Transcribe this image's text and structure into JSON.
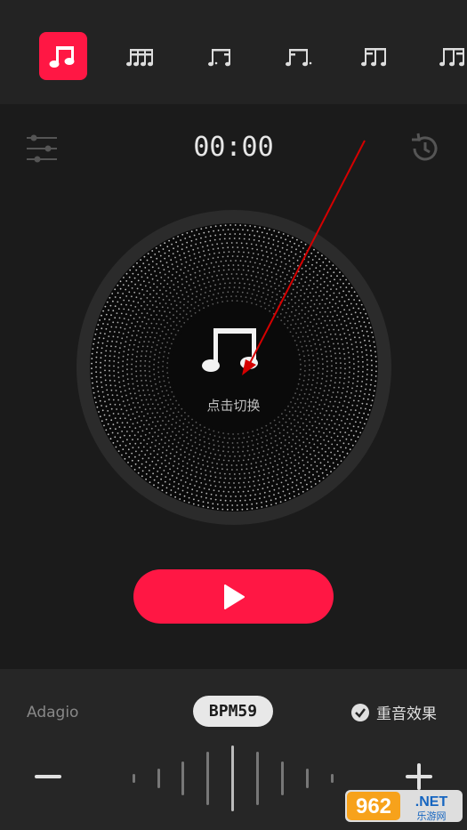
{
  "note_tabs": [
    {
      "name": "eighth-notes",
      "active": true
    },
    {
      "name": "sixteenth-notes",
      "active": false
    },
    {
      "name": "dotted-eighth-sixteenth",
      "active": false
    },
    {
      "name": "sixteenth-dotted-eighth",
      "active": false
    },
    {
      "name": "triplet-notes",
      "active": false
    },
    {
      "name": "sixteenth-group",
      "active": false
    }
  ],
  "timer": "00:00",
  "dial": {
    "label": "点击切换",
    "icon": "eighth-notes-icon"
  },
  "controls": {
    "left_icon": "sliders-icon",
    "right_icon": "history-icon",
    "play_icon": "play-icon"
  },
  "bottom": {
    "tempo_name": "Adagio",
    "bpm_label": "BPM59",
    "accent_label": "重音效果",
    "accent_checked": true
  },
  "watermark": {
    "text": "962.NET",
    "subtext": "乐游网"
  },
  "colors": {
    "accent": "#ff1744",
    "background": "#1b1b1b",
    "panel": "#232323"
  }
}
